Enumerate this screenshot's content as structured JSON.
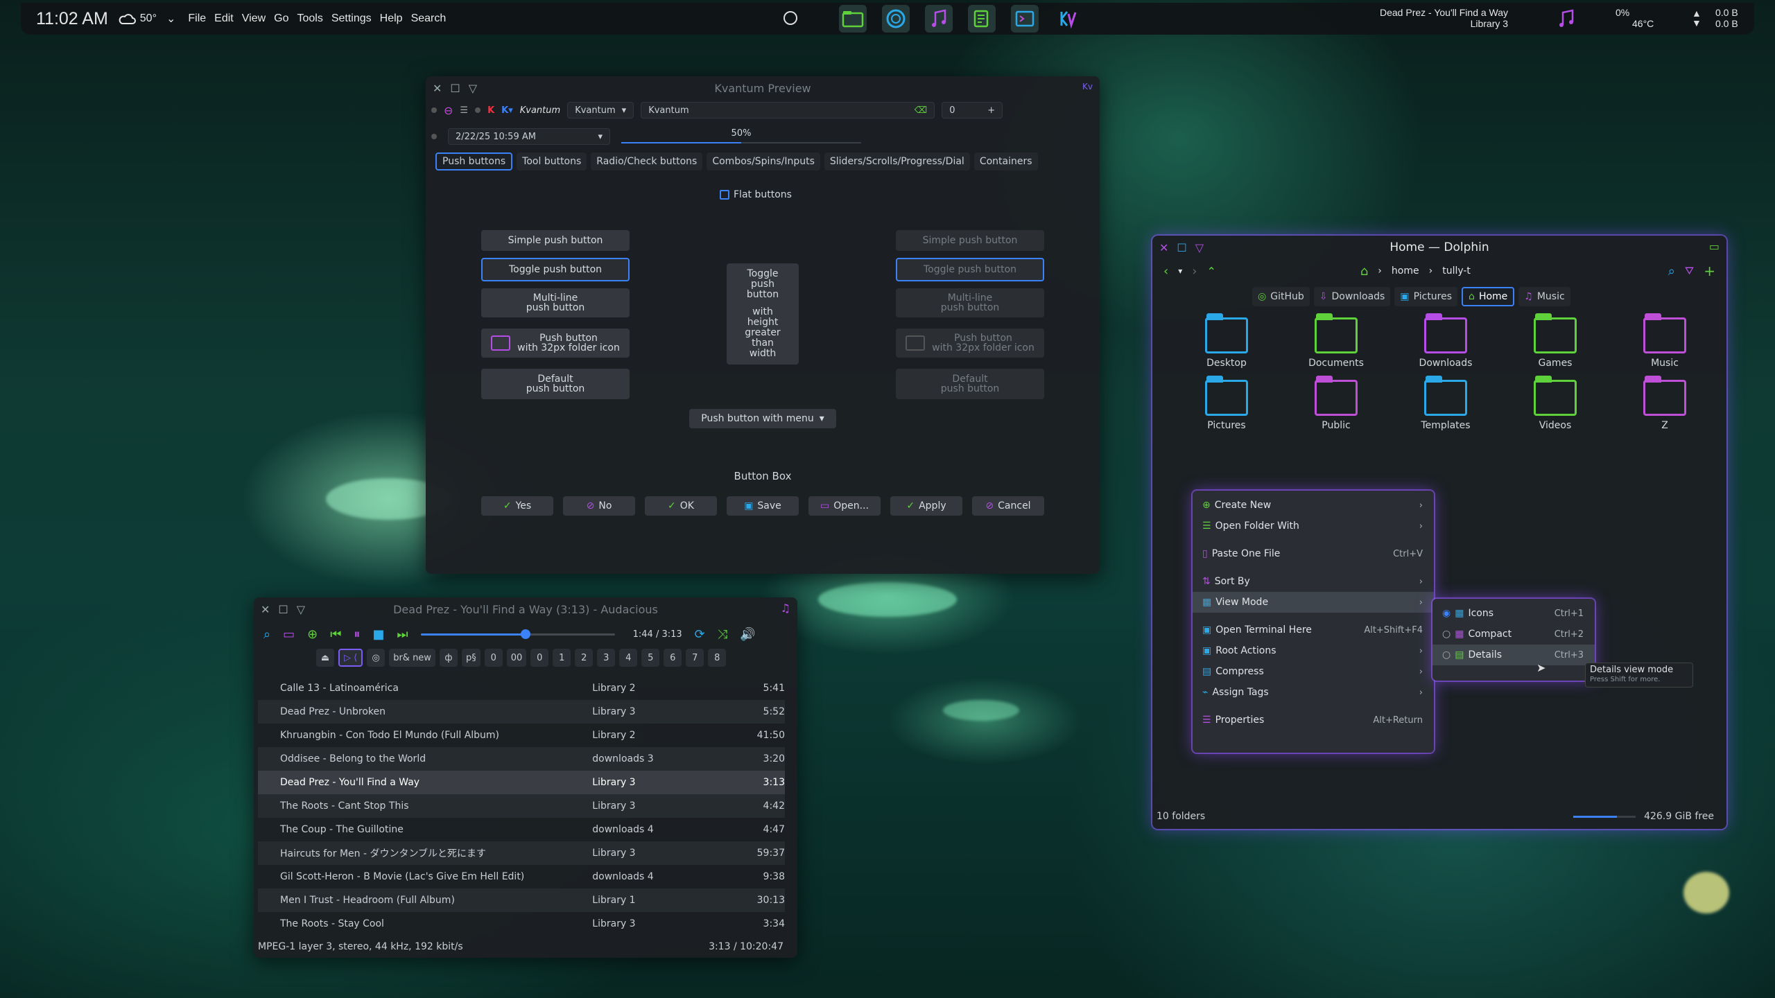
{
  "panel": {
    "clock": "11:02 AM",
    "temp": "50°",
    "menu": [
      "File",
      "Edit",
      "View",
      "Go",
      "Tools",
      "Settings",
      "Help",
      "Search"
    ],
    "media_title": "Dead Prez - You'll Find a Way",
    "media_album": "Library 3",
    "cpu": "0%",
    "cpu_temp": "46°C",
    "net_up": "0.0 B",
    "net_down": "0.0 B"
  },
  "kvantum": {
    "title": "Kvantum Preview",
    "label": "Kvantum",
    "theme_combo": "Kvantum",
    "theme_text": "Kvantum",
    "spin": "0",
    "datetime": "2/22/25 10:59 AM",
    "progress": "50%",
    "progress_value": 0.5,
    "tabs": [
      "Push buttons",
      "Tool buttons",
      "Radio/Check buttons",
      "Combos/Spins/Inputs",
      "Sliders/Scrolls/Progress/Dial",
      "Containers"
    ],
    "flat_label": "Flat buttons",
    "simple": "Simple push button",
    "toggle": "Toggle push button",
    "multi1": "Multi-line",
    "multi2": "push button",
    "icon1": "Push button",
    "icon2": "with 32px folder icon",
    "default1": "Default",
    "default2": "push button",
    "tall": [
      "Toggle",
      "push",
      "button",
      "",
      "with",
      "height",
      "greater",
      "than",
      "width"
    ],
    "menu_btn": "Push button with menu",
    "bbox_title": "Button Box",
    "bbox": [
      "Yes",
      "No",
      "OK",
      "Save",
      "Open...",
      "Apply",
      "Cancel"
    ]
  },
  "audacious": {
    "title": "Dead Prez - You'll Find a Way (3:13) - Audacious",
    "time": "1:44 / 3:13",
    "seek_value": 0.54,
    "chips": [
      "br& new",
      "0",
      "00",
      "0",
      "1",
      "2",
      "3",
      "4",
      "5",
      "6",
      "7",
      "8"
    ],
    "playlist": [
      {
        "title": "Calle 13 - Latinoamérica",
        "album": "Library 2",
        "len": "5:41"
      },
      {
        "title": "Dead Prez - Unbroken",
        "album": "Library 3",
        "len": "5:52"
      },
      {
        "title": "Khruangbin - Con Todo El Mundo (Full Album)",
        "album": "Library 2",
        "len": "41:50"
      },
      {
        "title": "Oddisee - Belong to the World",
        "album": "downloads 3",
        "len": "3:20"
      },
      {
        "title": "Dead Prez - You'll Find a Way",
        "album": "Library 3",
        "len": "3:13"
      },
      {
        "title": "The Roots - Cant Stop This",
        "album": "Library 3",
        "len": "4:42"
      },
      {
        "title": "The Coup - The Guillotine",
        "album": "downloads 4",
        "len": "4:47"
      },
      {
        "title": "Haircuts for Men - ダウンタンブルと死にます",
        "album": "Library 3",
        "len": "59:37"
      },
      {
        "title": "Gil Scott-Heron - B Movie (Lac's Give Em Hell Edit)",
        "album": "downloads 4",
        "len": "9:38"
      },
      {
        "title": "Men I Trust - Headroom (Full Album)",
        "album": "Library 1",
        "len": "30:13"
      },
      {
        "title": "The Roots - Stay Cool",
        "album": "Library 3",
        "len": "3:34"
      }
    ],
    "status_left": "MPEG-1 layer 3, stereo, 44 kHz, 192 kbit/s",
    "status_right": "3:13 / 10:20:47"
  },
  "dolphin": {
    "title": "Home — Dolphin",
    "crumb": [
      "home",
      "tully-t"
    ],
    "places": [
      "GitHub",
      "Downloads",
      "Pictures",
      "Home",
      "Music"
    ],
    "folders": [
      {
        "name": "Desktop",
        "color": "#2aa8e8"
      },
      {
        "name": "Documents",
        "color": "#5fd13b"
      },
      {
        "name": "Downloads",
        "color": "#b54de6"
      },
      {
        "name": "Games",
        "color": "#5fd13b"
      },
      {
        "name": "Music",
        "color": "#c04fd8"
      },
      {
        "name": "Pictures",
        "color": "#2aa8e8"
      },
      {
        "name": "Public",
        "color": "#c04fd8"
      },
      {
        "name": "Templates",
        "color": "#2aa8e8"
      },
      {
        "name": "Videos",
        "color": "#5fd13b"
      },
      {
        "name": "Z",
        "color": "#c04fd8"
      }
    ],
    "status_left": "10 folders",
    "status_right": "426.9 GiB free",
    "free_value": 0.7
  },
  "context": {
    "items": [
      {
        "label": "Create New",
        "sc": "›"
      },
      {
        "label": "Open Folder With",
        "sc": "›"
      },
      {
        "label": "Paste One File",
        "sc": "Ctrl+V"
      },
      {
        "label": "Sort By",
        "sc": "›"
      },
      {
        "label": "View Mode",
        "sc": "›"
      },
      {
        "label": "Open Terminal Here",
        "sc": "Alt+Shift+F4"
      },
      {
        "label": "Root Actions",
        "sc": "›"
      },
      {
        "label": "Compress",
        "sc": "›"
      },
      {
        "label": "Assign Tags",
        "sc": "›"
      },
      {
        "label": "Properties",
        "sc": "Alt+Return"
      }
    ],
    "sub": [
      {
        "label": "Icons",
        "sc": "Ctrl+1"
      },
      {
        "label": "Compact",
        "sc": "Ctrl+2"
      },
      {
        "label": "Details",
        "sc": "Ctrl+3"
      }
    ],
    "tip_title": "Details view mode",
    "tip_sub": "Press Shift for more."
  }
}
